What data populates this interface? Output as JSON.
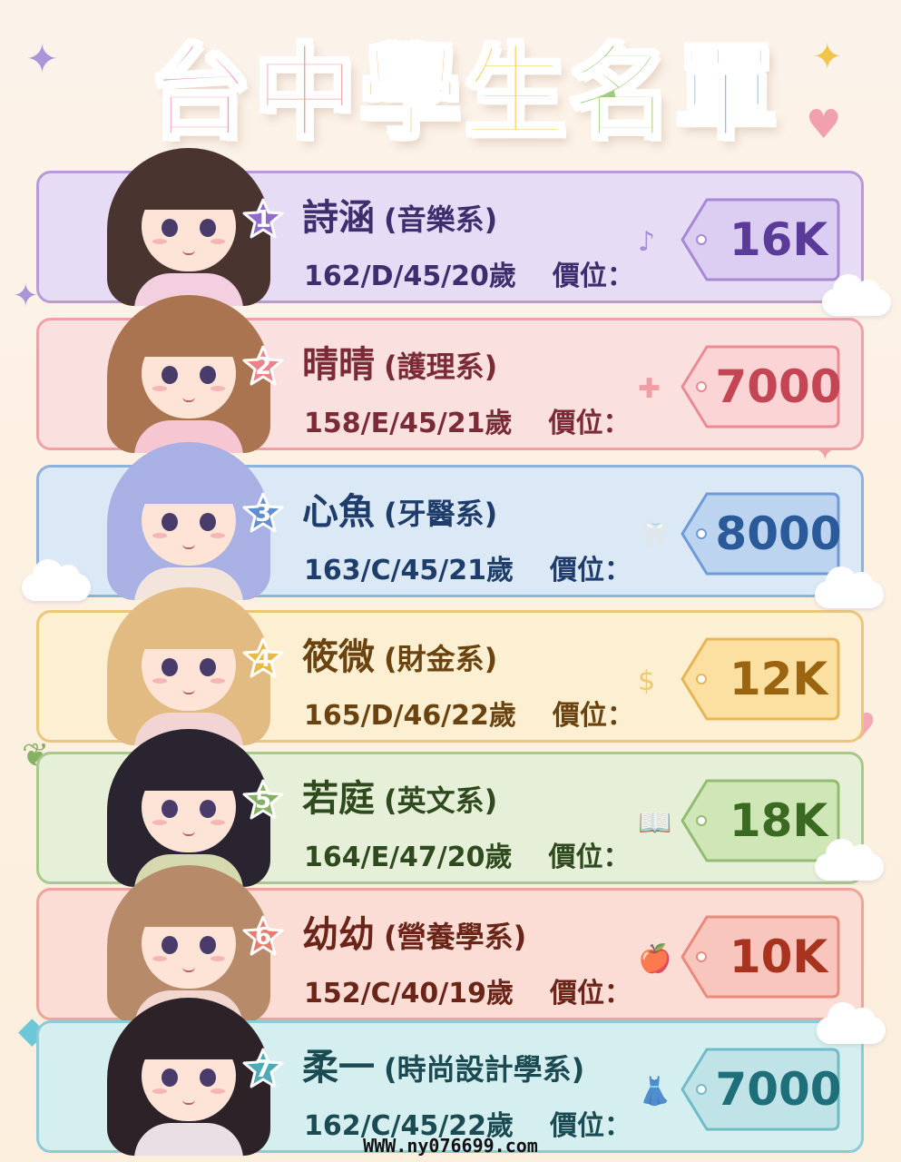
{
  "title": {
    "chars": [
      {
        "text": "台",
        "color": "#f2a0b0"
      },
      {
        "text": "中",
        "color": "#f09c9a"
      },
      {
        "text": "學",
        "color": "#f6bf7f"
      },
      {
        "text": "生",
        "color": "#f5cf5a"
      },
      {
        "text": "名",
        "color": "#9ecb7d"
      },
      {
        "text": "單",
        "color": "#8fb4e6"
      }
    ]
  },
  "price_label": "價位：",
  "students": [
    {
      "rank": "1",
      "name": "詩涵",
      "dept": "(音樂系)",
      "stats": "162/D/45/20歲",
      "price": "16K",
      "bg": "#e6dcf6",
      "border": "#b89ad8",
      "ink": "#3d2e6e",
      "accent": "#8f6ccb",
      "tag_bg": "#dccdf2",
      "tag_border": "#a888d4",
      "price_ink": "#5b3b9a",
      "hair": "#4a3430",
      "outfit": "#f3cfe0",
      "icon": "♪",
      "icon_name": "music-note-icon"
    },
    {
      "rank": "2",
      "name": "晴晴",
      "dept": "(護理系)",
      "stats": "158/E/45/21歲",
      "price": "7000",
      "bg": "#fbe0e0",
      "border": "#eda2a8",
      "ink": "#7a2b36",
      "accent": "#e9838c",
      "tag_bg": "#fbd4d6",
      "tag_border": "#e98b93",
      "price_ink": "#c44654",
      "hair": "#a9744f",
      "outfit": "#f6c6d2",
      "icon": "✚",
      "icon_name": "medical-cross-icon"
    },
    {
      "rank": "3",
      "name": "心魚",
      "dept": "(牙醫系)",
      "stats": "163/C/45/21歲",
      "price": "8000",
      "bg": "#dbe8f6",
      "border": "#8eb1de",
      "ink": "#1f3d6a",
      "accent": "#5f8fd0",
      "tag_bg": "#bcd4f0",
      "tag_border": "#6e9bd6",
      "price_ink": "#2a5a9a",
      "hair": "#a9b0e3",
      "outfit": "#f3e4dc",
      "icon": "🦷",
      "icon_name": "tooth-icon"
    },
    {
      "rank": "4",
      "name": "筱微",
      "dept": "(財金系)",
      "stats": "165/D/46/22歲",
      "price": "12K",
      "bg": "#fdf0d2",
      "border": "#ebc77a",
      "ink": "#6a4310",
      "accent": "#e8b84a",
      "tag_bg": "#fbe0a2",
      "tag_border": "#e6b558",
      "price_ink": "#9a6410",
      "hair": "#e2bb82",
      "outfit": "#f3d4d4",
      "icon": "$",
      "icon_name": "dollar-icon"
    },
    {
      "rank": "5",
      "name": "若庭",
      "dept": "(英文系)",
      "stats": "164/E/47/20歲",
      "price": "18K",
      "bg": "#e6f0d8",
      "border": "#a8c98a",
      "ink": "#2f4a1e",
      "accent": "#86b064",
      "tag_bg": "#cfe6b6",
      "tag_border": "#93bb72",
      "price_ink": "#3a6a22",
      "hair": "#2a2430",
      "outfit": "#d6d9b0",
      "icon": "📖",
      "icon_name": "book-icon"
    },
    {
      "rank": "6",
      "name": "幼幼",
      "dept": "(營養學系)",
      "stats": "152/C/40/19歲",
      "price": "10K",
      "bg": "#fbddd6",
      "border": "#eda59a",
      "ink": "#6a2418",
      "accent": "#e57c6c",
      "tag_bg": "#f8c6bc",
      "tag_border": "#e98a7c",
      "price_ink": "#a8341f",
      "hair": "#b78a6a",
      "outfit": "#f3d6d0",
      "icon": "🍎",
      "icon_name": "apple-icon"
    },
    {
      "rank": "7",
      "name": "柔一",
      "dept": "(時尚設計學系)",
      "stats": "162/C/45/22歲",
      "price": "7000",
      "bg": "#d5eef0",
      "border": "#8cccd4",
      "ink": "#1a4a52",
      "accent": "#4eaab6",
      "tag_bg": "#bfe3e7",
      "tag_border": "#70bcc6",
      "price_ink": "#1f6f7a",
      "hair": "#2c2228",
      "outfit": "#eadfe4",
      "icon": "👗",
      "icon_name": "dress-form-icon"
    }
  ],
  "footer": "WWW.ny076699.com"
}
